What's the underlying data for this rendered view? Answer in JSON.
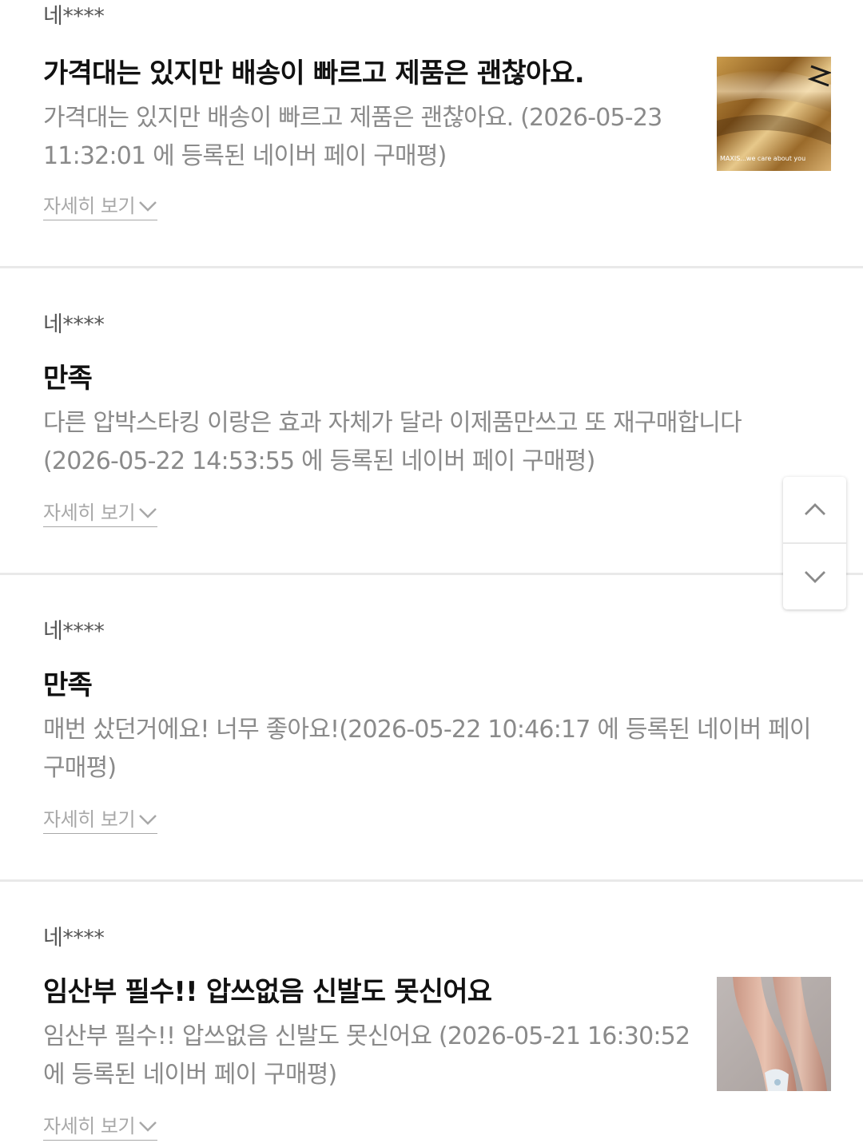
{
  "reviews": [
    {
      "author": "네****",
      "title": "가격대는 있지만 배송이 빠르고 제품은 괜찮아요.",
      "body": "가격대는 있지만 배송이 빠르고 제품은 괜찮아요. (2026-05-23 11:32:01 에 등록된 네이버 페이 구매평)",
      "more_label": "자세히 보기",
      "has_photo": true,
      "photo_caption": "MAXIS...we care about you"
    },
    {
      "author": "네****",
      "title": "만족",
      "body": "다른 압박스타킹 이랑은 효과 자체가 달라 이제품만쓰고 또 재구매합니다(2026-05-22 14:53:55 에 등록된 네이버 페이 구매평)",
      "more_label": "자세히 보기",
      "has_photo": false
    },
    {
      "author": "네****",
      "title": "만족",
      "body": "매번 샀던거에요! 너무 좋아요!(2026-05-22 10:46:17 에 등록된 네이버 페이 구매평)",
      "more_label": "자세히 보기",
      "has_photo": false
    },
    {
      "author": "네****",
      "title": "임산부 필수!! 압쓰없음 신발도 못신어요",
      "body": "임산부 필수!! 압쓰없음 신발도 못신어요 (2026-05-21 16:30:52 에 등록된 네이버 페이 구매평)",
      "more_label": "자세히 보기",
      "has_photo": true
    }
  ],
  "scroll_controls": {
    "up_icon": "chevron-up-icon",
    "down_icon": "chevron-down-icon"
  },
  "colors": {
    "title": "#111111",
    "author": "#555555",
    "body": "#8a8a8a",
    "more_link": "#a8a8a8",
    "divider": "#e9e9e9"
  }
}
